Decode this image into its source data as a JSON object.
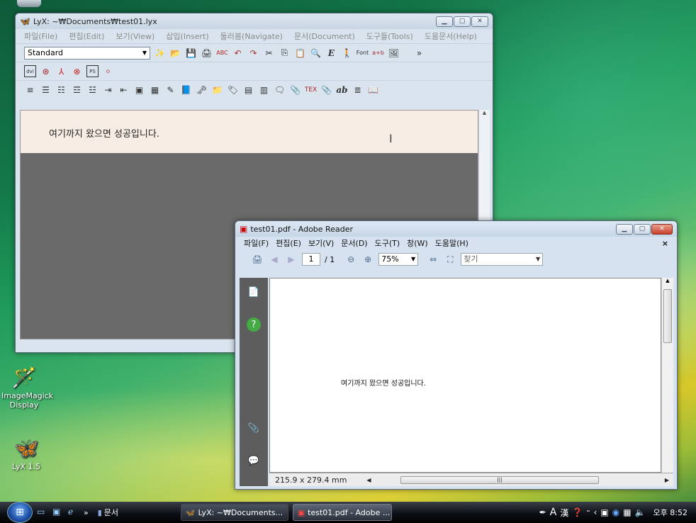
{
  "lyx": {
    "title": "LyX: ~₩Documents₩test01.lyx",
    "menu": [
      "파일(File)",
      "편집(Edit)",
      "보기(View)",
      "삽입(Insert)",
      "둘러봄(Navigate)",
      "문서(Document)",
      "도구들(Tools)",
      "도움문서(Help)"
    ],
    "layout_value": "Standard",
    "more_label": "»",
    "font_label": "Font",
    "document_text": "여기까지 왔으면 성공입니다."
  },
  "adobe": {
    "title": "test01.pdf - Adobe Reader",
    "menu": [
      "파일(F)",
      "편집(E)",
      "보기(V)",
      "문서(D)",
      "도구(T)",
      "창(W)",
      "도움말(H)"
    ],
    "close_doc": "×",
    "page_current": "1",
    "page_total": "/ 1",
    "zoom": "75%",
    "find_placeholder": "찾기",
    "page_text": "여기까지 왔으면 성공입니다.",
    "page_size": "215.9 x 279.4 mm"
  },
  "desktop": {
    "icons": [
      {
        "label": "ImageMagick Display"
      },
      {
        "label": "LyX 1.5"
      }
    ]
  },
  "taskbar": {
    "chevron": "»",
    "folder_label": "문서",
    "buttons": [
      "LyX: ~₩Documents...",
      "test01.pdf - Adobe ..."
    ],
    "clock": "오후 8:52"
  }
}
